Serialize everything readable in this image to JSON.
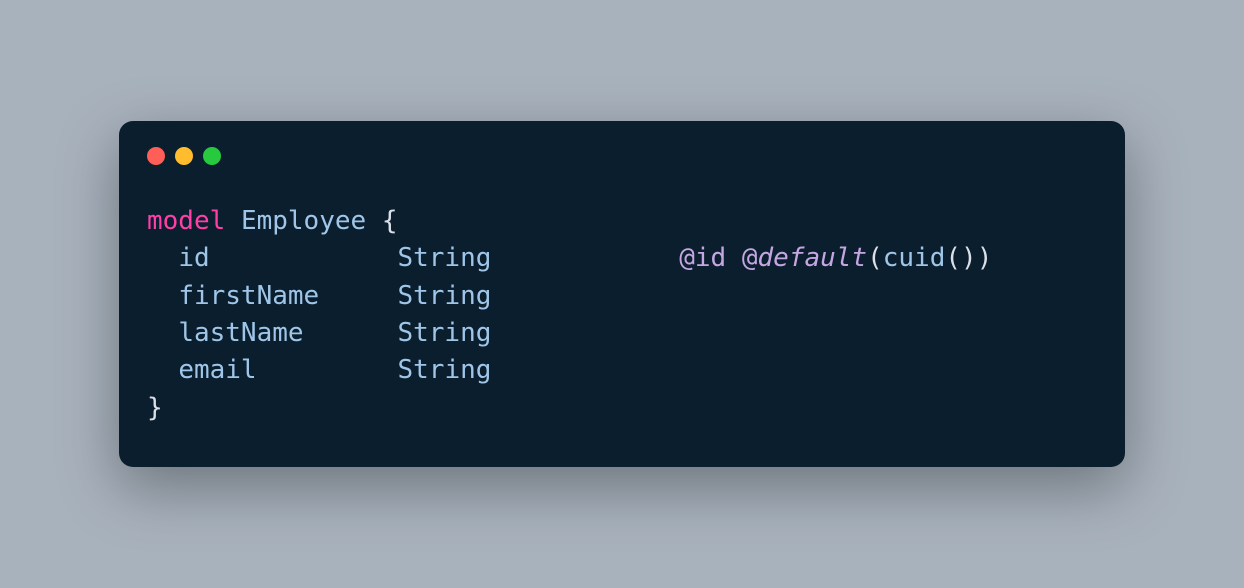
{
  "code": {
    "keyword_model": "model",
    "model_name": "Employee",
    "brace_open": "{",
    "brace_close": "}",
    "fields": [
      {
        "name": "id",
        "type": "String",
        "attrs": {
          "id": "@id",
          "default_label": "default",
          "at": "@",
          "func": "cuid",
          "paren_open": "(",
          "paren_close": ")",
          "paren_open2": "(",
          "paren_close2": ")"
        }
      },
      {
        "name": "firstName",
        "type": "String"
      },
      {
        "name": "lastName",
        "type": "String"
      },
      {
        "name": "email",
        "type": "String"
      }
    ],
    "spaces": {
      "indent": "  ",
      "name_pad_id": "            ",
      "name_pad_firstName": "     ",
      "name_pad_lastName": "      ",
      "name_pad_email": "         ",
      "type_to_attr": "            "
    }
  }
}
